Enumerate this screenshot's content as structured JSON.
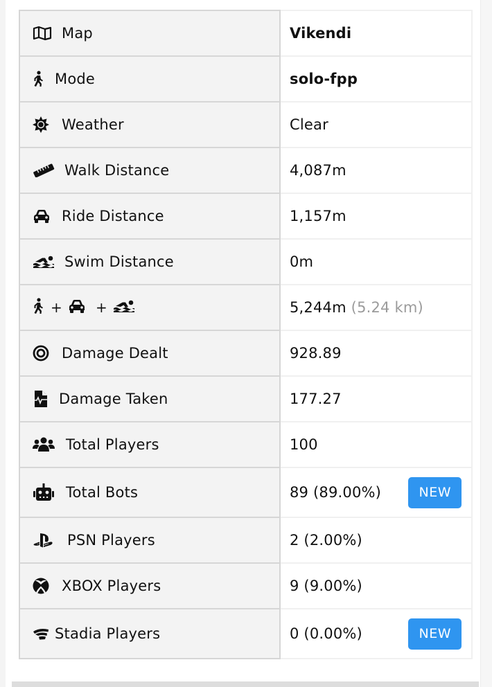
{
  "rows": [
    {
      "label": "Map",
      "icon": "map-icon",
      "value": "Vikendi",
      "bold": true
    },
    {
      "label": "Mode",
      "icon": "walking-icon",
      "value": "solo-fpp",
      "bold": true
    },
    {
      "label": "Weather",
      "icon": "sun-icon",
      "value": "Clear"
    },
    {
      "label": "Walk Distance",
      "icon": "ruler-icon",
      "value": "4,087m"
    },
    {
      "label": "Ride Distance",
      "icon": "car-icon",
      "value": "1,157m"
    },
    {
      "label": "Swim Distance",
      "icon": "swimmer-icon",
      "value": "0m"
    },
    {
      "label": "",
      "icon": "walk-ride-swim-combined-icons",
      "combo_plus": "+",
      "value": "5,244m",
      "value_secondary": "(5.24 km)"
    },
    {
      "label": "Damage Dealt",
      "icon": "target-icon",
      "value": "928.89"
    },
    {
      "label": "Damage Taken",
      "icon": "medical-file-icon",
      "value": "177.27"
    },
    {
      "label": "Total Players",
      "icon": "users-icon",
      "value": "100"
    },
    {
      "label": "Total Bots",
      "icon": "robot-icon",
      "value": "89 (89.00%)",
      "badge": "NEW"
    },
    {
      "label": "PSN Players",
      "icon": "playstation-icon",
      "value": "2 (2.00%)"
    },
    {
      "label": "XBOX Players",
      "icon": "xbox-icon",
      "value": "9 (9.00%)"
    },
    {
      "label": "Stadia Players",
      "icon": "stadia-icon",
      "value": "0 (0.00%)",
      "badge": "NEW"
    }
  ],
  "colors": {
    "badge_bg": "#2f95f0",
    "label_bg": "#f3f3f3",
    "muted_text": "#9b9b9b"
  }
}
